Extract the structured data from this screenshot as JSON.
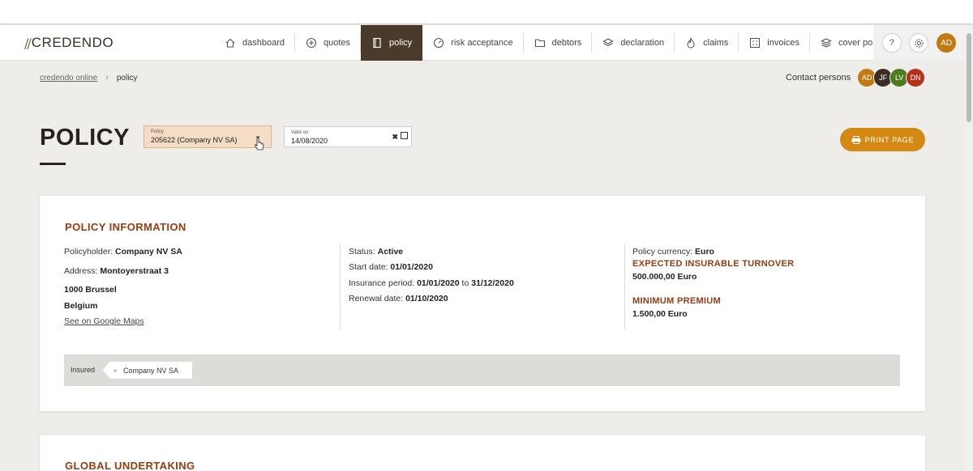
{
  "brand": {
    "name": "CREDENDO"
  },
  "nav": {
    "items": [
      {
        "label": "dashboard",
        "icon": "home-icon"
      },
      {
        "label": "quotes",
        "icon": "plus-circle-icon"
      },
      {
        "label": "policy",
        "icon": "document-icon",
        "active": true
      },
      {
        "label": "risk acceptance",
        "icon": "gauge-icon"
      },
      {
        "label": "debtors",
        "icon": "folder-icon"
      },
      {
        "label": "declaration",
        "icon": "layers-icon"
      },
      {
        "label": "claims",
        "icon": "flame-icon"
      },
      {
        "label": "invoices",
        "icon": "grid-icon"
      },
      {
        "label": "cover policy",
        "icon": "stack-icon"
      }
    ],
    "help_icon": "?",
    "user_initials": "AD"
  },
  "breadcrumb": {
    "home": "credendo online",
    "current": "policy"
  },
  "contacts": {
    "label": "Contact persons",
    "persons": [
      {
        "initials": "AD",
        "color": "#c07a0f"
      },
      {
        "initials": "JF",
        "color": "#3b2e26"
      },
      {
        "initials": "LV",
        "color": "#4f7a1f"
      },
      {
        "initials": "DN",
        "color": "#b8301a"
      }
    ]
  },
  "page": {
    "title": "POLICY"
  },
  "policy_select": {
    "label": "Policy",
    "value": "205622 (Company NV SA)"
  },
  "date_field": {
    "label": "Valid on",
    "value": "14/08/2020",
    "clear": "✖"
  },
  "print_button": {
    "label": "PRINT PAGE"
  },
  "policy_info": {
    "title": "POLICY INFORMATION",
    "policyholder_label": "Policyholder:",
    "policyholder": "Company NV SA",
    "address_label": "Address:",
    "address_street": "Montoyerstraat 3",
    "address_city": "1000 Brussel",
    "address_country": "Belgium",
    "maps_link": "See on Google Maps",
    "status_label": "Status:",
    "status": "Active",
    "start_label": "Start date:",
    "start_date": "01/01/2020",
    "period_label": "Insurance period:",
    "period_from": "01/01/2020",
    "period_to_word": "to",
    "period_to": "31/12/2020",
    "renewal_label": "Renewal date:",
    "renewal_date": "01/10/2020",
    "currency_label": "Policy currency:",
    "currency": "Euro",
    "turnover_title": "EXPECTED INSURABLE TURNOVER",
    "turnover_value": "500.000,00 Euro",
    "premium_title": "MINIMUM PREMIUM",
    "premium_value": "1.500,00 Euro",
    "insured_label": "Insured",
    "insured_tag": "Company NV SA"
  },
  "global_undertaking": {
    "title": "GLOBAL UNDERTAKING"
  },
  "colors": {
    "accent": "#d48a12",
    "brand_dark": "#4a3a2c",
    "section_title": "#9a3a10"
  }
}
